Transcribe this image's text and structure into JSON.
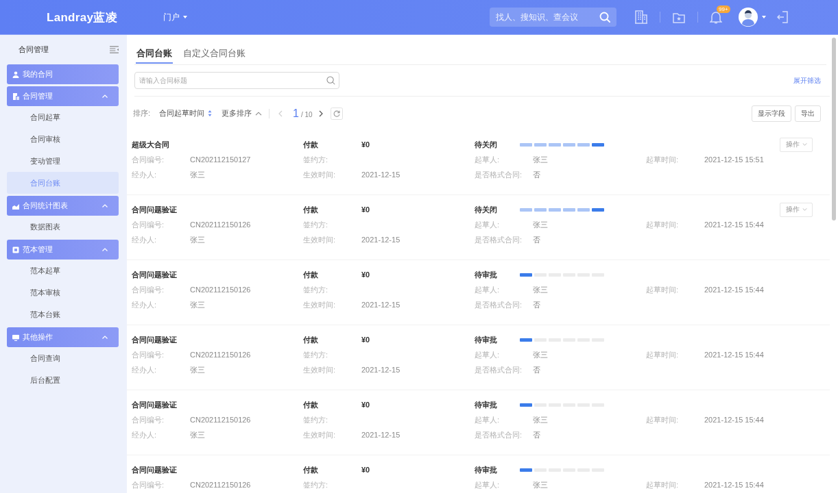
{
  "header": {
    "logo": "Landray蓝凌",
    "portal_menu": "门户",
    "search": {
      "placeholder": "找人、搜知识、查会议"
    },
    "notification_badge": "99+"
  },
  "sidebar": {
    "title": "合同管理",
    "groups": [
      {
        "label": "我的合同",
        "kind": "link"
      },
      {
        "label": "合同管理",
        "kind": "folder",
        "expanded": true,
        "children": [
          {
            "label": "合同起草",
            "selected": false
          },
          {
            "label": "合同审核",
            "selected": false
          },
          {
            "label": "变动管理",
            "selected": false
          },
          {
            "label": "合同台账",
            "selected": true
          }
        ]
      },
      {
        "label": "合同统计图表",
        "kind": "folder",
        "expanded": true,
        "children": [
          {
            "label": "数据图表",
            "selected": false
          }
        ]
      },
      {
        "label": "范本管理",
        "kind": "folder",
        "expanded": true,
        "children": [
          {
            "label": "范本起草",
            "selected": false
          },
          {
            "label": "范本审核",
            "selected": false
          },
          {
            "label": "范本台账",
            "selected": false
          }
        ]
      },
      {
        "label": "其他操作",
        "kind": "folder",
        "expanded": true,
        "children": [
          {
            "label": "合同查询",
            "selected": false
          },
          {
            "label": "后台配置",
            "selected": false
          }
        ]
      }
    ]
  },
  "tabs": [
    {
      "label": "合同台账",
      "selected": true
    },
    {
      "label": "自定义合同台账",
      "selected": false
    }
  ],
  "search": {
    "placeholder": "请输入合同标题"
  },
  "filter_toggle": "展开筛选",
  "toolbar": {
    "sort_label": "排序:",
    "sort_field": "合同起草时间",
    "more_sort": "更多排序",
    "pager": {
      "page": "1",
      "total": "/ 10",
      "prev_disabled": true,
      "next_disabled": false
    },
    "buttons": [
      "显示字段",
      "导出"
    ]
  },
  "rows": [
    {
      "title": "超级大合同",
      "type": "付款",
      "amount": "¥0",
      "status": "待关闭",
      "steps": [
        {
          "kind": "done"
        },
        {
          "kind": "done"
        },
        {
          "kind": "done"
        },
        {
          "kind": "done"
        },
        {
          "kind": "done"
        },
        {
          "kind": "current"
        }
      ],
      "action": "操作",
      "lines": [
        [
          {
            "label": "合同编号:",
            "value": "CN202112150127"
          },
          {
            "label": "签约方:"
          },
          {
            "label": "起草人:",
            "value": "张三"
          },
          {
            "label": "起草时间:",
            "value": "2021-12-15 15:51"
          }
        ],
        [
          {
            "label": "经办人:",
            "value": "张三"
          },
          {
            "label": "生效时间:",
            "value": "2021-12-15"
          },
          {
            "label": "是否格式合同:",
            "value": "否"
          }
        ]
      ]
    },
    {
      "title": "合同问题验证",
      "type": "付款",
      "amount": "¥0",
      "status": "待关闭",
      "steps": [
        {
          "kind": "done"
        },
        {
          "kind": "done"
        },
        {
          "kind": "done"
        },
        {
          "kind": "done"
        },
        {
          "kind": "done"
        },
        {
          "kind": "current"
        }
      ],
      "action": "操作",
      "lines": [
        [
          {
            "label": "合同编号:",
            "value": "CN202112150126"
          },
          {
            "label": "签约方:"
          },
          {
            "label": "起草人:",
            "value": "张三"
          },
          {
            "label": "起草时间:",
            "value": "2021-12-15 15:44"
          }
        ],
        [
          {
            "label": "经办人:",
            "value": "张三"
          },
          {
            "label": "生效时间:",
            "value": "2021-12-15"
          },
          {
            "label": "是否格式合同:",
            "value": "否"
          }
        ]
      ]
    },
    {
      "title": "合同问题验证",
      "type": "付款",
      "amount": "¥0",
      "status": "待审批",
      "steps": [
        {
          "kind": "current"
        },
        {
          "kind": "todo"
        },
        {
          "kind": "todo"
        },
        {
          "kind": "todo"
        },
        {
          "kind": "todo"
        },
        {
          "kind": "todo"
        }
      ],
      "lines": [
        [
          {
            "label": "合同编号:",
            "value": "CN202112150126"
          },
          {
            "label": "签约方:"
          },
          {
            "label": "起草人:",
            "value": "张三"
          },
          {
            "label": "起草时间:",
            "value": "2021-12-15 15:44"
          }
        ],
        [
          {
            "label": "经办人:",
            "value": "张三"
          },
          {
            "label": "生效时间:",
            "value": "2021-12-15"
          },
          {
            "label": "是否格式合同:",
            "value": "否"
          }
        ]
      ]
    },
    {
      "title": "合同问题验证",
      "type": "付款",
      "amount": "¥0",
      "status": "待审批",
      "steps": [
        {
          "kind": "current"
        },
        {
          "kind": "todo"
        },
        {
          "kind": "todo"
        },
        {
          "kind": "todo"
        },
        {
          "kind": "todo"
        },
        {
          "kind": "todo"
        }
      ],
      "lines": [
        [
          {
            "label": "合同编号:",
            "value": "CN202112150126"
          },
          {
            "label": "签约方:"
          },
          {
            "label": "起草人:",
            "value": "张三"
          },
          {
            "label": "起草时间:",
            "value": "2021-12-15 15:44"
          }
        ],
        [
          {
            "label": "经办人:",
            "value": "张三"
          },
          {
            "label": "生效时间:",
            "value": "2021-12-15"
          },
          {
            "label": "是否格式合同:",
            "value": "否"
          }
        ]
      ]
    },
    {
      "title": "合同问题验证",
      "type": "付款",
      "amount": "¥0",
      "status": "待审批",
      "steps": [
        {
          "kind": "current"
        },
        {
          "kind": "todo"
        },
        {
          "kind": "todo"
        },
        {
          "kind": "todo"
        },
        {
          "kind": "todo"
        },
        {
          "kind": "todo"
        }
      ],
      "lines": [
        [
          {
            "label": "合同编号:",
            "value": "CN202112150126"
          },
          {
            "label": "签约方:"
          },
          {
            "label": "起草人:",
            "value": "张三"
          },
          {
            "label": "起草时间:",
            "value": "2021-12-15 15:44"
          }
        ],
        [
          {
            "label": "经办人:",
            "value": "张三"
          },
          {
            "label": "生效时间:",
            "value": "2021-12-15"
          },
          {
            "label": "是否格式合同:",
            "value": "否"
          }
        ]
      ]
    },
    {
      "title": "合同问题验证",
      "type": "付款",
      "amount": "¥0",
      "status": "待审批",
      "steps": [
        {
          "kind": "current"
        },
        {
          "kind": "todo"
        },
        {
          "kind": "todo"
        },
        {
          "kind": "todo"
        },
        {
          "kind": "todo"
        },
        {
          "kind": "todo"
        }
      ],
      "lines": [
        [
          {
            "label": "合同编号:",
            "value": "CN202112150126"
          },
          {
            "label": "签约方:"
          },
          {
            "label": "起草人:",
            "value": "张三"
          },
          {
            "label": "起草时间:",
            "value": "2021-12-15 15:44"
          }
        ]
      ]
    }
  ]
}
